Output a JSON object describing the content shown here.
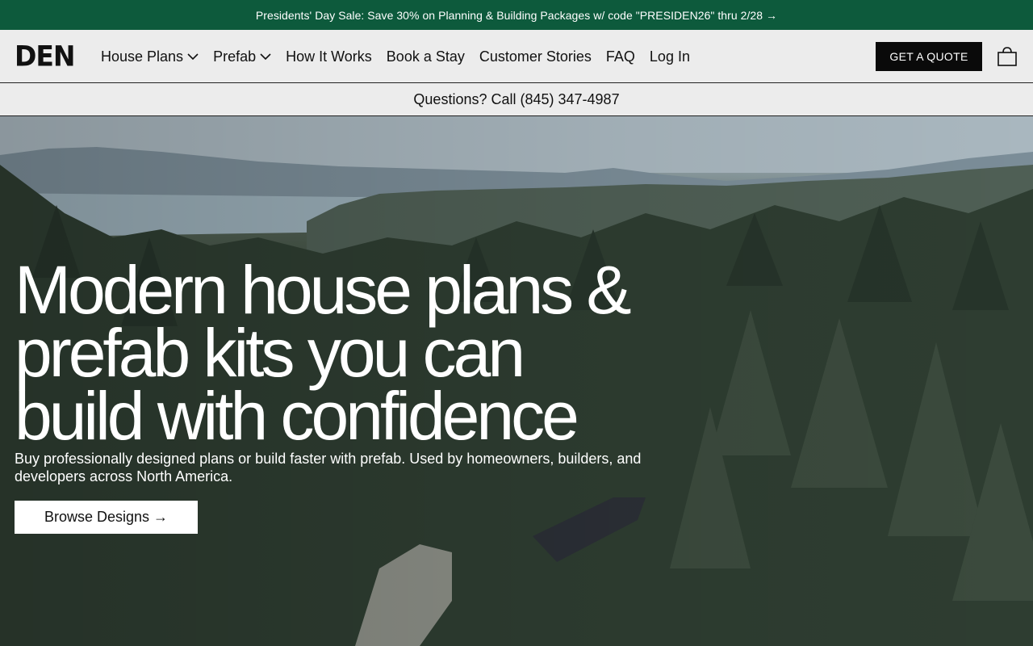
{
  "promo": {
    "text": "Presidents' Day Sale: Save 30% on Planning & Building Packages w/ code \"PRESIDEN26\" thru 2/28 →",
    "background": "#0d5a3c"
  },
  "nav": {
    "logo": "DEN",
    "links": [
      {
        "label": "House Plans",
        "has_dropdown": true
      },
      {
        "label": "Prefab",
        "has_dropdown": true
      },
      {
        "label": "How It Works",
        "has_dropdown": false
      },
      {
        "label": "Book a Stay",
        "has_dropdown": false
      },
      {
        "label": "Customer Stories",
        "has_dropdown": false
      },
      {
        "label": "FAQ",
        "has_dropdown": false
      },
      {
        "label": "Log In",
        "has_dropdown": false
      }
    ],
    "quote_button": "GET A QUOTE",
    "cart_icon": "shopping-bag-icon"
  },
  "phone_bar": {
    "text": "Questions? Call (845) 347-4987"
  },
  "hero": {
    "headline_lines": [
      "Modern house plans &",
      "prefab kits you can",
      "build with confidence"
    ],
    "subtext": "Buy professionally designed plans or build faster with prefab. Used by homeowners, builders, and developers across North America.",
    "cta": "Browse Designs →"
  }
}
